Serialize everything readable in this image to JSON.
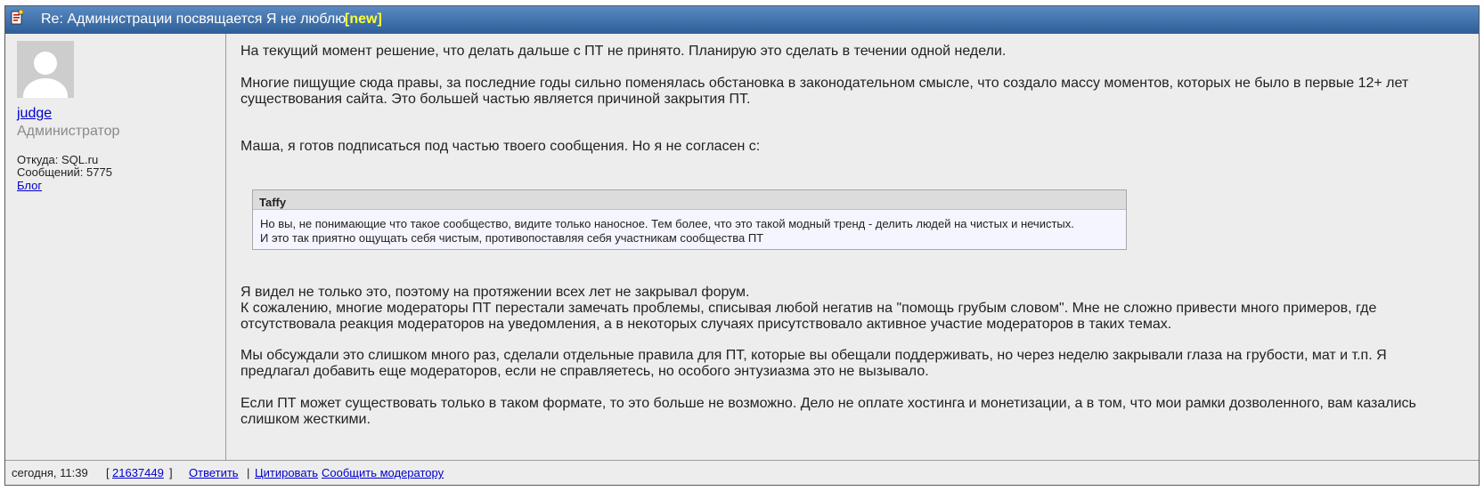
{
  "header": {
    "title": "Re: Администрации посвящается Я не люблю",
    "new_badge": "[new]"
  },
  "author": {
    "name": "judge ",
    "role": "Администратор",
    "from": "Откуда: SQL.ru",
    "messages": "Сообщений: 5775",
    "blog": "Блог"
  },
  "body": {
    "p1": "На текущий момент решение, что делать дальше с ПТ не принято. Планирую это сделать в течении одной недели.",
    "p2a": "Многие пищущие сюда правы, за последние годы сильно поменялась обстановка в законодательном смысле, что создало массу моментов, которых не было в первые 12+ лет",
    "p2b": "существования сайта. Это большей частью является причиной закрытия ПТ.",
    "p3": "Маша, я готов подписаться под частью твоего сообщения. Но я не согласен с:",
    "p4a": "Я видел не только это, поэтому на протяжении всех лет не закрывал форум.",
    "p4b": "К сожалению, многие модераторы ПТ перестали замечать проблемы, списывая любой негатив на \"помощь грубым словом\". Мне не сложно привести много примеров, где",
    "p4c": "отсутствовала реакция модераторов на уведомления, а в некоторых случаях присутствовало активное участие модераторов в таких темах.",
    "p5a": "Мы обсуждали это слишком много раз, сделали отдельные правила для ПТ, которые вы обещали поддерживать, но через неделю закрывали глаза на грубости, мат и т.п. Я",
    "p5b": "предлагал добавить еще модераторов, если не справляетесь, но особого энтузиазма это не вызывало.",
    "p6a": "Если ПТ может существовать только в таком формате, то это больше не возможно. Дело не оплате хостинга и монетизации, а в том, что мои рамки дозволенного, вам казались",
    "p6b": "слишком жесткими."
  },
  "quote": {
    "author": "Taffy",
    "line1": "Но вы, не понимающие что такое сообщество, видите только наносное. Тем более, что это такой модный тренд - делить людей на чистых и нечистых.",
    "line2": "И это так приятно ощущать себя чистым, противопоставляя себя участникам сообщества ПТ"
  },
  "footer": {
    "timestamp": "сегодня, 11:39",
    "bracket_open": "[",
    "post_id": "21637449",
    "bracket_close": "]",
    "reply": "Ответить",
    "separator": "|",
    "cite": "Цитировать",
    "report": "Сообщить модератору"
  },
  "colors": {
    "header_bg": "#3b6aa6",
    "new_badge": "#ffff33",
    "link": "#0000cc"
  },
  "icons": {
    "header": "message-icon",
    "avatar": "default-avatar-icon"
  }
}
